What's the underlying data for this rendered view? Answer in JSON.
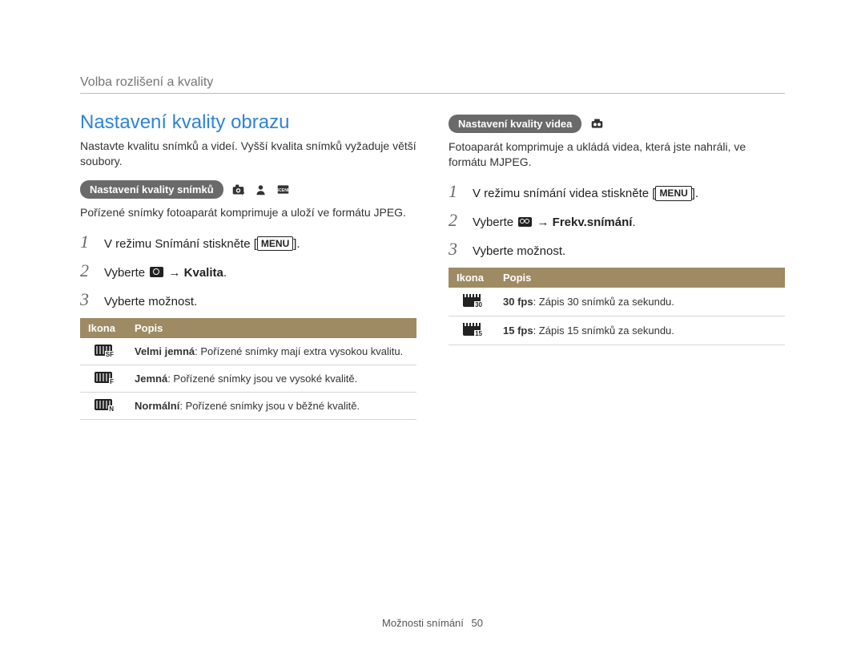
{
  "header": {
    "breadcrumb": "Volba rozlišení a kvality"
  },
  "left": {
    "heading": "Nastavení kvality obrazu",
    "intro": "Nastavte kvalitu snímků a videí. Vyšší kvalita snímků vyžaduje větší soubory.",
    "pill": "Nastavení kvality snímků",
    "subtext": "Pořízené snímky fotoaparát komprimuje a uloží ve formátu JPEG.",
    "steps": {
      "s1_pre": "V režimu Snímání stiskněte [",
      "s1_menu": "MENU",
      "s1_post": "].",
      "s2_pre": "Vyberte ",
      "s2_arrow": " → ",
      "s2_bold": "Kvalita",
      "s2_post": ".",
      "s3": "Vyberte možnost."
    },
    "table": {
      "col1": "Ikona",
      "col2": "Popis",
      "rows": [
        {
          "icon_sub": "SF",
          "bold": "Velmi jemná",
          "rest": ": Pořízené snímky mají extra vysokou kvalitu."
        },
        {
          "icon_sub": "F",
          "bold": "Jemná",
          "rest": ": Pořízené snímky jsou ve vysoké kvalitě."
        },
        {
          "icon_sub": "N",
          "bold": "Normální",
          "rest": ": Pořízené snímky jsou v běžné kvalitě."
        }
      ]
    }
  },
  "right": {
    "pill": "Nastavení kvality videa",
    "subtext": "Fotoaparát komprimuje a ukládá videa, která jste nahráli, ve formátu MJPEG.",
    "steps": {
      "s1_pre": "V režimu snímání videa stiskněte [",
      "s1_menu": "MENU",
      "s1_post": "].",
      "s2_pre": "Vyberte ",
      "s2_arrow": " → ",
      "s2_bold": "Frekv.snímání",
      "s2_post": ".",
      "s3": "Vyberte možnost."
    },
    "table": {
      "col1": "Ikona",
      "col2": "Popis",
      "rows": [
        {
          "icon_sub": "30",
          "bold": "30 fps",
          "rest": ": Zápis 30 snímků za sekundu."
        },
        {
          "icon_sub": "15",
          "bold": "15 fps",
          "rest": ": Zápis 15 snímků za sekundu."
        }
      ]
    }
  },
  "footer": {
    "section": "Možnosti snímání",
    "page": "50"
  }
}
